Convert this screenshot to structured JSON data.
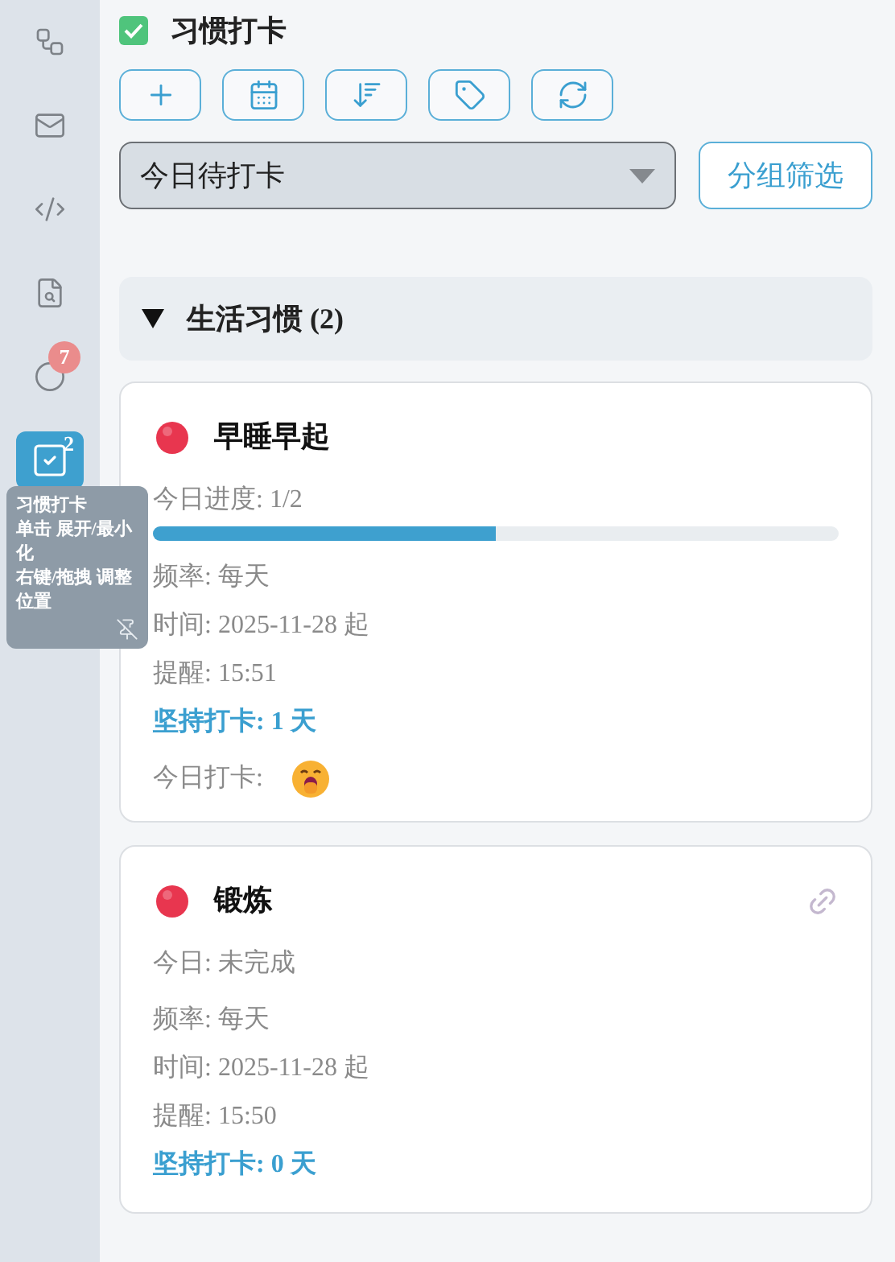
{
  "sidebar": {
    "items": [
      {
        "kind": "network",
        "selected": false
      },
      {
        "kind": "mail",
        "selected": false
      },
      {
        "kind": "code",
        "selected": false
      },
      {
        "kind": "file-search",
        "selected": false
      },
      {
        "kind": "timer",
        "selected": false,
        "badge": "7"
      },
      {
        "kind": "checklist",
        "selected": true,
        "badge": "2"
      }
    ]
  },
  "tooltip": {
    "lines": [
      "习惯打卡",
      "单击 展开/最小化",
      "右键/拖拽 调整位置"
    ]
  },
  "header": {
    "title": "习惯打卡",
    "checked": true
  },
  "toolbar": [
    {
      "kind": "add"
    },
    {
      "kind": "calendar"
    },
    {
      "kind": "sort"
    },
    {
      "kind": "tag"
    },
    {
      "kind": "refresh"
    }
  ],
  "filter": {
    "value": "今日待打卡",
    "button": "分组筛选"
  },
  "group": {
    "title": "生活习惯 (2)",
    "expanded": true
  },
  "habits": [
    {
      "name": "早睡早起",
      "color": "#e8364f",
      "linked": false,
      "status": "今日进度: 1/2",
      "level": 0.5,
      "frequency": "频率: 每天",
      "time": "时间: 2025-11-28 起",
      "reminder": "提醒: 15:51",
      "streak": "坚持打卡: 1 天",
      "checkin_label": "今日打卡:"
    },
    {
      "name": "锻炼",
      "color": "#e8364f",
      "linked": true,
      "status": "今日: 未完成",
      "frequency": "频率: 每天",
      "time": "时间: 2025-11-28 起",
      "reminder": "提醒: 15:50",
      "streak": "坚持打卡: 0 天"
    }
  ]
}
